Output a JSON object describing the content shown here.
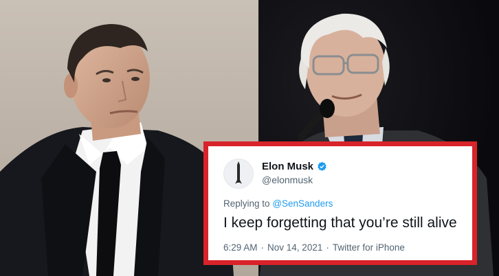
{
  "tweet": {
    "display_name": "Elon Musk",
    "handle": "@elonmusk",
    "verified_icon": "verified-badge-icon",
    "reply_prefix": "Replying to",
    "reply_handle": "@SenSanders",
    "text": "I keep forgetting that you’re still alive",
    "time": "6:29 AM",
    "date": "Nov 14, 2021",
    "source": "Twitter for iPhone",
    "separator": "·"
  },
  "colors": {
    "frame": "#d8232a",
    "link": "#1d9bf0",
    "verified": "#1d9bf0",
    "secondary_text": "#536471"
  }
}
